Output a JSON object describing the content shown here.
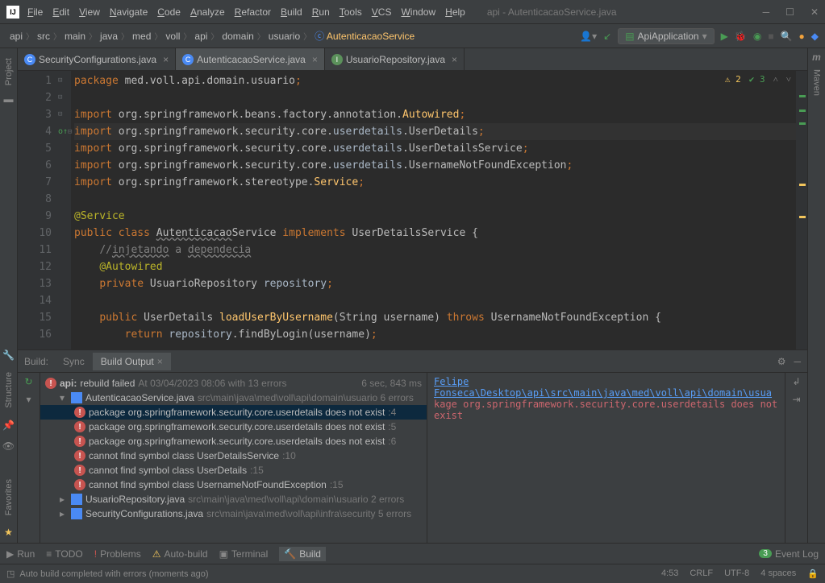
{
  "window": {
    "title": "api - AutenticacaoService.java",
    "menu": [
      "File",
      "Edit",
      "View",
      "Navigate",
      "Code",
      "Analyze",
      "Refactor",
      "Build",
      "Run",
      "Tools",
      "VCS",
      "Window",
      "Help"
    ]
  },
  "breadcrumbs": [
    "api",
    "src",
    "main",
    "java",
    "med",
    "voll",
    "api",
    "domain",
    "usuario",
    "AutenticacaoService"
  ],
  "run_config": "ApiApplication",
  "tabs": [
    {
      "icon": "c",
      "label": "SecurityConfigurations.java",
      "active": false
    },
    {
      "icon": "c",
      "label": "AutenticacaoService.java",
      "active": true
    },
    {
      "icon": "i",
      "label": "UsuarioRepository.java",
      "active": false
    }
  ],
  "inspections": {
    "warnings": "2",
    "ok": "3"
  },
  "code_lines": [
    {
      "n": 1,
      "html": "<span class='kw'>package</span> med.voll.api.domain.usuario<span class='kw'>;</span>"
    },
    {
      "n": 2,
      "html": ""
    },
    {
      "n": 3,
      "html": "<span class='kw'>import</span> org.springframework.beans.factory.annotation.<span class='svc'>Autowired</span><span class='kw'>;</span>",
      "fold": "⊟"
    },
    {
      "n": 4,
      "html": "<span class='kw'>import</span> org.springframework.security.core.<span class='cls'>userdetails</span>.UserDetails<span class='kw'>;</span>",
      "hl": true
    },
    {
      "n": 5,
      "html": "<span class='kw'>import</span> org.springframework.security.core.<span class='cls'>userdetails</span>.UserDetailsService<span class='kw'>;</span>"
    },
    {
      "n": 6,
      "html": "<span class='kw'>import</span> org.springframework.security.core.<span class='cls'>userdetails</span>.UsernameNotFoundException<span class='kw'>;</span>"
    },
    {
      "n": 7,
      "html": "<span class='kw'>import</span> org.springframework.stereotype.<span class='svc'>Service</span><span class='kw'>;</span>",
      "fold": "⊟"
    },
    {
      "n": 8,
      "html": ""
    },
    {
      "n": 9,
      "html": "<span class='ann'>@Service</span>"
    },
    {
      "n": 10,
      "html": "<span class='kw'>public class</span> <span class='wavy'>Autenticacao</span>Service <span class='kw'>implements</span> UserDetailsService {",
      "fold": "⊟"
    },
    {
      "n": 11,
      "html": "    <span class='cmt'>//<span class='wavy'>injetando</span> a <span class='wavy'>dependecia</span></span>"
    },
    {
      "n": 12,
      "html": "    <span class='ann'>@Autowired</span>"
    },
    {
      "n": 13,
      "html": "    <span class='kw'>private</span> UsuarioRepository <span class='cls'>repository</span><span class='kw'>;</span>"
    },
    {
      "n": 14,
      "html": ""
    },
    {
      "n": 15,
      "html": "    <span class='kw'>public</span> UserDetails <span class='svc'>loadUserByUsername</span>(String username) <span class='kw'>throws</span> UsernameNotFoundException {",
      "fold": "⊟",
      "icon": "o↑"
    },
    {
      "n": 16,
      "html": "        <span class='kw'>return</span> <span class='cls'>repository</span>.findByLogin(username)<span class='kw'>;</span>"
    }
  ],
  "build": {
    "panel_label": "Build:",
    "tabs": [
      "Sync",
      "Build Output"
    ],
    "active_tab": 1,
    "header": {
      "name": "api:",
      "status": "rebuild failed",
      "time": "At 03/04/2023 08:06 with 13 errors",
      "duration": "6 sec, 843 ms"
    },
    "tree": [
      {
        "type": "file",
        "indent": 1,
        "label": "AutenticacaoService.java",
        "path": "src\\main\\java\\med\\voll\\api\\domain\\usuario",
        "suffix": "6 errors",
        "expand": "▾"
      },
      {
        "type": "err",
        "indent": 2,
        "label": "package org.springframework.security.core.userdetails does not exist",
        "line": ":4",
        "sel": true
      },
      {
        "type": "err",
        "indent": 2,
        "label": "package org.springframework.security.core.userdetails does not exist",
        "line": ":5"
      },
      {
        "type": "err",
        "indent": 2,
        "label": "package org.springframework.security.core.userdetails does not exist",
        "line": ":6"
      },
      {
        "type": "err",
        "indent": 2,
        "label": "cannot find symbol class UserDetailsService",
        "line": ":10"
      },
      {
        "type": "err",
        "indent": 2,
        "label": "cannot find symbol class UserDetails",
        "line": ":15"
      },
      {
        "type": "err",
        "indent": 2,
        "label": "cannot find symbol class UsernameNotFoundException",
        "line": ":15"
      },
      {
        "type": "file",
        "indent": 1,
        "label": "UsuarioRepository.java",
        "path": "src\\main\\java\\med\\voll\\api\\domain\\usuario",
        "suffix": "2 errors",
        "expand": "▸"
      },
      {
        "type": "file",
        "indent": 1,
        "label": "SecurityConfigurations.java",
        "path": "src\\main\\java\\med\\voll\\api\\infra\\security",
        "suffix": "5 errors",
        "expand": "▸"
      }
    ],
    "output_link": "Felipe Fonseca\\Desktop\\api\\src\\main\\java\\med\\voll\\api\\domain\\usua",
    "output_err": "kage org.springframework.security.core.userdetails does not exist"
  },
  "bottom_tools": [
    {
      "icon": "▶",
      "label": "Run"
    },
    {
      "icon": "≡",
      "label": "TODO"
    },
    {
      "icon": "!",
      "label": "Problems",
      "color": "#c75450"
    },
    {
      "icon": "⚠",
      "label": "Auto-build",
      "color": "#f2c55c"
    },
    {
      "icon": "▣",
      "label": "Terminal"
    },
    {
      "icon": "🔨",
      "label": "Build",
      "active": true
    }
  ],
  "event_log": {
    "count": "3",
    "label": "Event Log"
  },
  "status": {
    "message": "Auto build completed with errors (moments ago)",
    "cursor": "4:53",
    "line_sep": "CRLF",
    "encoding": "UTF-8",
    "indent": "4 spaces"
  },
  "side_labels": {
    "project": "Project",
    "structure": "Structure",
    "favorites": "Favorites",
    "maven": "Maven"
  }
}
